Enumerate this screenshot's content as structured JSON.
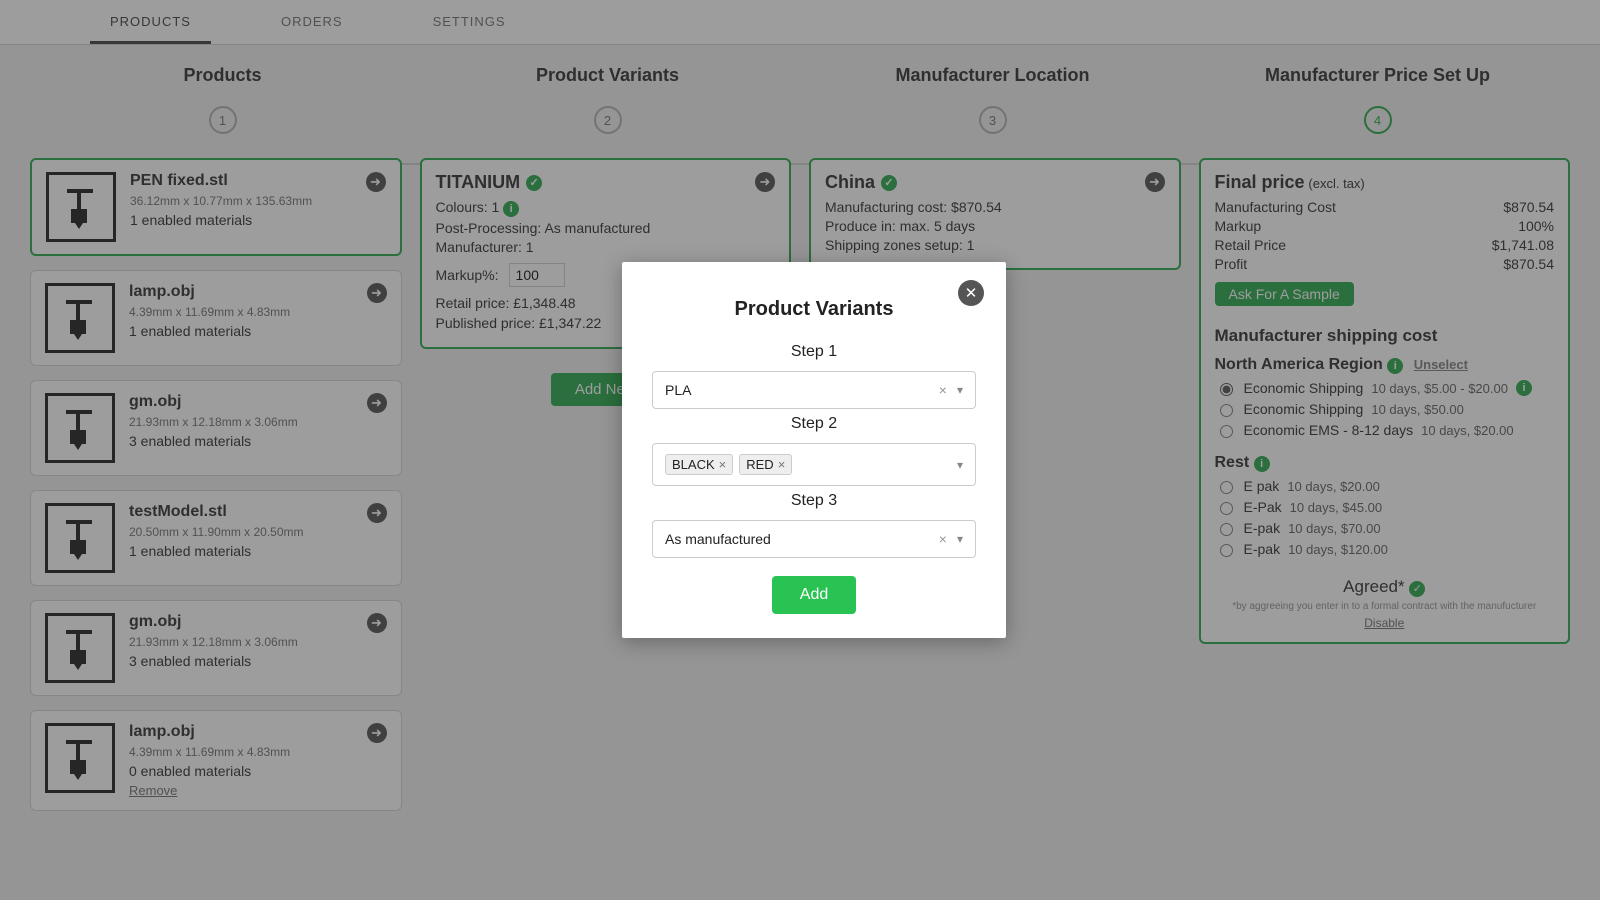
{
  "tabs": [
    "PRODUCTS",
    "ORDERS",
    "SETTINGS"
  ],
  "steps": [
    {
      "label": "Products",
      "num": "1"
    },
    {
      "label": "Product Variants",
      "num": "2"
    },
    {
      "label": "Manufacturer Location",
      "num": "3"
    },
    {
      "label": "Manufacturer Price Set Up",
      "num": "4"
    }
  ],
  "products": [
    {
      "title": "PEN fixed.stl",
      "dims": "36.12mm x 10.77mm x 135.63mm",
      "meta": "1 enabled materials",
      "selected": true
    },
    {
      "title": "lamp.obj",
      "dims": "4.39mm x 11.69mm x 4.83mm",
      "meta": "1 enabled materials"
    },
    {
      "title": "gm.obj",
      "dims": "21.93mm x 12.18mm x 3.06mm",
      "meta": "3 enabled materials"
    },
    {
      "title": "testModel.stl",
      "dims": "20.50mm x 11.90mm x 20.50mm",
      "meta": "1 enabled materials"
    },
    {
      "title": "gm.obj",
      "dims": "21.93mm x 12.18mm x 3.06mm",
      "meta": "3 enabled materials"
    },
    {
      "title": "lamp.obj",
      "dims": "4.39mm x 11.69mm x 4.83mm",
      "meta": "0 enabled materials",
      "remove": "Remove"
    }
  ],
  "variant": {
    "title": "TITANIUM",
    "colours_label": "Colours: 1",
    "post": "Post-Processing: As manufactured",
    "manuf": "Manufacturer: 1",
    "markup_label": "Markup%:",
    "markup_value": "100",
    "retail": "Retail price: £1,348.48",
    "published": "Published price: £1,347.22",
    "add_new": "Add New"
  },
  "location": {
    "title": "China",
    "cost": "Manufacturing cost: $870.54",
    "produce": "Produce in: max. 5 days",
    "zones": "Shipping zones setup: 1"
  },
  "pricing": {
    "title": "Final price",
    "title_sub": "(excl. tax)",
    "rows": [
      {
        "k": "Manufacturing Cost",
        "v": "$870.54"
      },
      {
        "k": "Markup",
        "v": "100%"
      },
      {
        "k": "Retail Price",
        "v": "$1,741.08"
      },
      {
        "k": "Profit",
        "v": "$870.54"
      }
    ],
    "sample": "Ask For A Sample",
    "ship_heading": "Manufacturer shipping cost",
    "region1": "North America Region",
    "unselect": "Unselect",
    "r1": [
      {
        "label": "Economic Shipping",
        "meta": "10 days, $5.00 - $20.00",
        "checked": true,
        "info": true
      },
      {
        "label": "Economic Shipping",
        "meta": "10 days, $50.00"
      },
      {
        "label": "Economic EMS - 8-12 days",
        "meta": "10 days, $20.00"
      }
    ],
    "region2": "Rest",
    "r2": [
      {
        "label": "E pak",
        "meta": "10 days, $20.00"
      },
      {
        "label": "E-Pak",
        "meta": "10 days, $45.00"
      },
      {
        "label": "E-pak",
        "meta": "10 days, $70.00"
      },
      {
        "label": "E-pak",
        "meta": "10 days, $120.00"
      }
    ],
    "agreed": "Agreed*",
    "fineprint": "*by aggreeing you enter in to a formal contract with the manufucturer",
    "disable": "Disable"
  },
  "modal": {
    "title": "Product Variants",
    "step1": "Step 1",
    "sel1": "PLA",
    "step2": "Step 2",
    "chips": [
      "BLACK",
      "RED"
    ],
    "step3": "Step 3",
    "sel3": "As manufactured",
    "add": "Add"
  }
}
